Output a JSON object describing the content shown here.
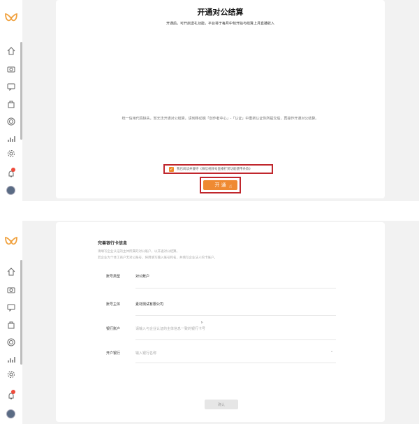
{
  "top": {
    "title": "开通对公结算",
    "subtitle": "开通后，可开启送礼功能，平台将于每月中旬开始与结算上月直播收入",
    "notice": "统一信用代码缺失，暂无法开通对公结算，请到移动端「创作者中心」-「认证」中重新认证你所提交后，再操作开通对公结算。",
    "agree_text": "我已阅读并遵守《微信视频号直播打赏功能使用条款》",
    "open_label": "开 通"
  },
  "bottom": {
    "section_title": "完善银行卡信息",
    "desc_1": "请填写企业认证的主体所属的对公账户，以开通对公结算。",
    "desc_2": "若企业为个体工商户无对公账号，将用填写输入账号和名，并填写企业法人的卡账户。",
    "rows": [
      {
        "label": "账号类型",
        "value": "对公账户"
      },
      {
        "label": "账号主体",
        "value": "素材测试有限公司"
      },
      {
        "label": "银行账户",
        "placeholder": "请输入与企业认证的主体信息一致的银行卡号"
      },
      {
        "label": "开户银行",
        "placeholder": "输入银行名称"
      }
    ],
    "confirm_label": "确认"
  },
  "colors": {
    "accent": "#ef8a32",
    "highlight": "#c0272d"
  },
  "icons": [
    "logo-icon",
    "home-icon",
    "camera-icon",
    "message-icon",
    "bag-icon",
    "target-icon",
    "chart-icon",
    "gear-icon",
    "bell-icon",
    "avatar"
  ]
}
